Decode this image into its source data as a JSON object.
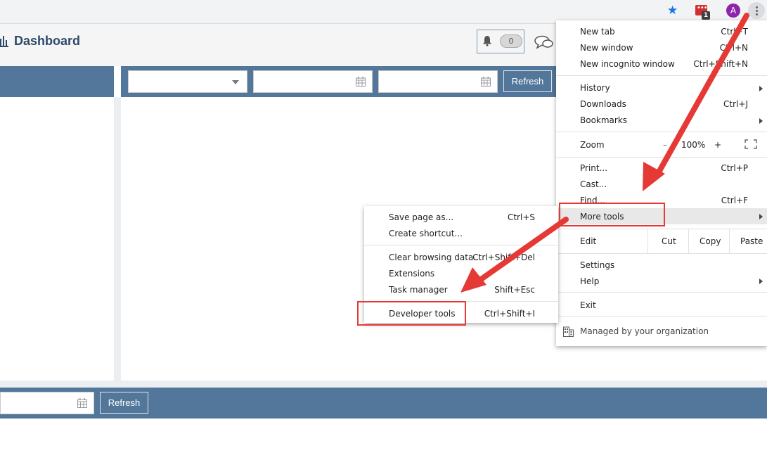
{
  "browser": {
    "avatar_letter": "A",
    "extension_badge": "1",
    "star_glyph": "★",
    "ext_dots_glyph": "•••"
  },
  "header": {
    "title": "Dashboard",
    "notification_count": "0"
  },
  "filters": {
    "refresh_label": "Refresh",
    "bottom_refresh_label": "Refresh"
  },
  "chrome_menu": {
    "new_tab": "New tab",
    "new_tab_shortcut": "Ctrl+T",
    "new_window": "New window",
    "new_window_shortcut": "Ctrl+N",
    "new_incognito": "New incognito window",
    "new_incognito_shortcut": "Ctrl+Shift+N",
    "history": "History",
    "downloads": "Downloads",
    "downloads_shortcut": "Ctrl+J",
    "bookmarks": "Bookmarks",
    "zoom": "Zoom",
    "zoom_minus": "–",
    "zoom_level": "100%",
    "zoom_plus": "+",
    "print": "Print...",
    "print_shortcut": "Ctrl+P",
    "cast": "Cast...",
    "find": "Find...",
    "find_shortcut": "Ctrl+F",
    "more_tools": "More tools",
    "edit": "Edit",
    "cut": "Cut",
    "copy": "Copy",
    "paste": "Paste",
    "settings": "Settings",
    "help": "Help",
    "exit": "Exit",
    "managed": "Managed by your organization"
  },
  "more_tools_menu": {
    "save_page": "Save page as...",
    "save_page_shortcut": "Ctrl+S",
    "create_shortcut": "Create shortcut...",
    "clear_data": "Clear browsing data...",
    "clear_data_shortcut": "Ctrl+Shift+Del",
    "extensions": "Extensions",
    "task_manager": "Task manager",
    "task_manager_shortcut": "Shift+Esc",
    "developer_tools": "Developer tools",
    "developer_tools_shortcut": "Ctrl+Shift+I"
  },
  "colors": {
    "accent_bar": "#52779a",
    "annotation_red": "#e53935",
    "title_text": "#2c4a6b"
  },
  "icons": [
    "star-icon",
    "extension-icon",
    "avatar",
    "chrome-menu-icon",
    "chart-icon",
    "bell-icon",
    "chat-icon",
    "dropdown-caret-icon",
    "calendar-icon",
    "fullscreen-icon",
    "building-icon",
    "submenu-arrow-icon"
  ]
}
